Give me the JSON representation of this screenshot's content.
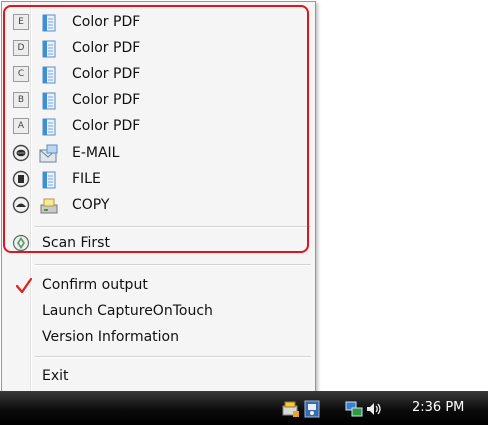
{
  "menu": {
    "jobs": [
      {
        "slot": "E",
        "label": "Color PDF",
        "icon": "file-icon"
      },
      {
        "slot": "D",
        "label": "Color PDF",
        "icon": "file-icon"
      },
      {
        "slot": "C",
        "label": "Color PDF",
        "icon": "file-icon"
      },
      {
        "slot": "B",
        "label": "Color PDF",
        "icon": "file-icon"
      },
      {
        "slot": "A",
        "label": "Color PDF",
        "icon": "file-icon"
      },
      {
        "label": "E-MAIL",
        "icon": "email-icon"
      },
      {
        "label": "FILE",
        "icon": "file-icon"
      },
      {
        "label": "COPY",
        "icon": "copy-icon"
      }
    ],
    "scan_first": "Scan First",
    "confirm_output": "Confirm output",
    "confirm_output_checked": true,
    "launch": "Launch CaptureOnTouch",
    "version": "Version Information",
    "exit": "Exit"
  },
  "taskbar": {
    "clock": "2:36 PM",
    "tray_icons": [
      "scanner-tray-icon",
      "capture-on-touch-tray-icon",
      "network-icon",
      "volume-icon"
    ]
  },
  "colors": {
    "highlight": "#e0141e",
    "check": "#e02020",
    "taskbar": "#000000"
  }
}
